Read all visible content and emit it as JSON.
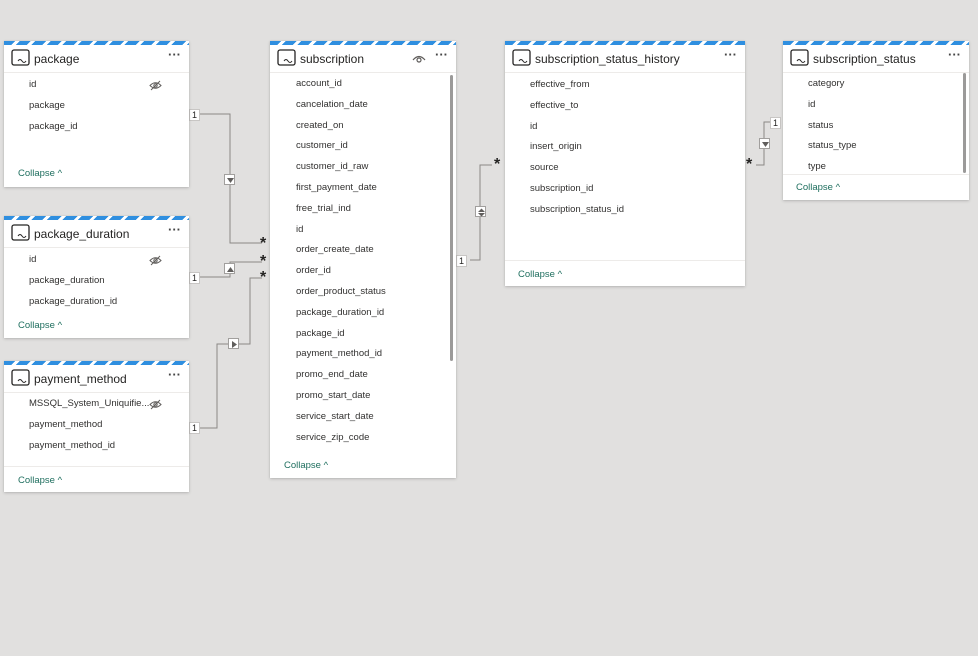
{
  "tables": {
    "package": {
      "title": "package",
      "fields": [
        "id",
        "package",
        "package_id"
      ],
      "hidden_fields": [
        "id"
      ],
      "collapse_label": "Collapse"
    },
    "package_duration": {
      "title": "package_duration",
      "fields": [
        "id",
        "package_duration",
        "package_duration_id"
      ],
      "hidden_fields": [
        "id"
      ],
      "collapse_label": "Collapse"
    },
    "payment_method": {
      "title": "payment_method",
      "fields": [
        "MSSQL_System_Uniquifie...",
        "payment_method",
        "payment_method_id"
      ],
      "hidden_fields": [
        "MSSQL_System_Uniquifie..."
      ],
      "collapse_label": "Collapse"
    },
    "subscription": {
      "title": "subscription",
      "table_hidden": true,
      "fields": [
        "account_id",
        "cancelation_date",
        "created_on",
        "customer_id",
        "customer_id_raw",
        "first_payment_date",
        "free_trial_ind",
        "id",
        "order_create_date",
        "order_id",
        "order_product_status",
        "package_duration_id",
        "package_id",
        "payment_method_id",
        "promo_end_date",
        "promo_start_date",
        "service_start_date",
        "service_zip_code"
      ],
      "collapse_label": "Collapse"
    },
    "subscription_status_history": {
      "title": "subscription_status_history",
      "fields": [
        "effective_from",
        "effective_to",
        "id",
        "insert_origin",
        "source",
        "subscription_id",
        "subscription_status_id"
      ],
      "collapse_label": "Collapse"
    },
    "subscription_status": {
      "title": "subscription_status",
      "fields": [
        "category",
        "id",
        "status",
        "status_type",
        "type"
      ],
      "collapse_label": "Collapse"
    }
  },
  "relationships": [
    {
      "from": "package",
      "to": "subscription",
      "from_card": "1",
      "to_card": "*",
      "filter": "single"
    },
    {
      "from": "package_duration",
      "to": "subscription",
      "from_card": "1",
      "to_card": "*",
      "filter": "single"
    },
    {
      "from": "payment_method",
      "to": "subscription",
      "from_card": "1",
      "to_card": "*",
      "filter": "single"
    },
    {
      "from": "subscription",
      "to": "subscription_status_history",
      "from_card": "1",
      "to_card": "*",
      "filter": "both"
    },
    {
      "from": "subscription_status",
      "to": "subscription_status_history",
      "from_card": "1",
      "to_card": "*",
      "filter": "single"
    }
  ],
  "menu_glyph": "···",
  "colors": {
    "canvas": "#e1e0df",
    "header_stripe": "#2f8fe0",
    "collapse_link": "#1f6f5f",
    "connector": "#8a8886"
  },
  "icons": {
    "table": "table-icon",
    "hidden": "eye-hidden-icon",
    "visible": "eye-icon",
    "more": "more-options-icon",
    "chevron": "chevron-up-icon"
  }
}
